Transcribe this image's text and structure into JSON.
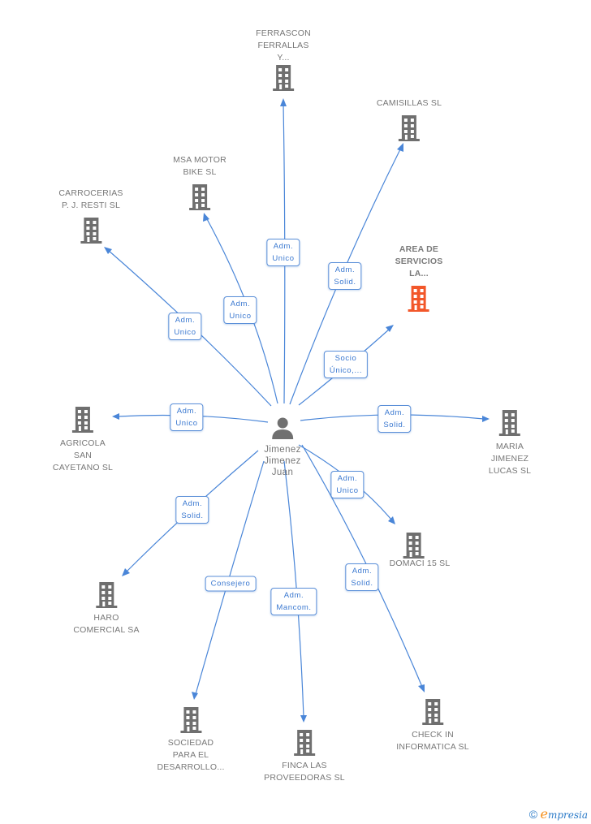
{
  "center": {
    "name_lines": [
      "Jimenez",
      "Jimenez",
      "Juan"
    ],
    "icon": "person-icon"
  },
  "companies": [
    {
      "id": "ferrascon",
      "lines": [
        "FERRASCON",
        "FERRALLAS",
        "Y..."
      ],
      "relation_lines": [
        "Adm.",
        "Unico"
      ],
      "highlight": false,
      "icon": "building-icon"
    },
    {
      "id": "camisillas",
      "lines": [
        "CAMISILLAS  SL"
      ],
      "relation_lines": [
        "Adm.",
        "Solid."
      ],
      "highlight": false,
      "icon": "building-icon"
    },
    {
      "id": "msa-motor",
      "lines": [
        "MSA MOTOR",
        "BIKE SL"
      ],
      "relation_lines": [
        "Adm.",
        "Unico"
      ],
      "highlight": false,
      "icon": "building-icon"
    },
    {
      "id": "carrocerias",
      "lines": [
        "CARROCERIAS",
        "P.  J. RESTI  SL"
      ],
      "relation_lines": [
        "Adm.",
        "Unico"
      ],
      "highlight": false,
      "icon": "building-icon"
    },
    {
      "id": "area-servicios",
      "lines": [
        "AREA DE",
        "SERVICIOS",
        "LA..."
      ],
      "relation_lines": [
        "Socio",
        "Único,..."
      ],
      "highlight": true,
      "icon": "building-icon"
    },
    {
      "id": "agricola",
      "lines": [
        "AGRICOLA",
        "SAN",
        "CAYETANO SL"
      ],
      "relation_lines": [
        "Adm.",
        "Unico"
      ],
      "highlight": false,
      "icon": "building-icon"
    },
    {
      "id": "maria-jimenez",
      "lines": [
        "MARIA",
        "JIMENEZ",
        "LUCAS SL"
      ],
      "relation_lines": [
        "Adm.",
        "Solid."
      ],
      "highlight": false,
      "icon": "building-icon"
    },
    {
      "id": "domaci",
      "lines": [
        "DOMACI 15 SL"
      ],
      "relation_lines": [
        "Adm.",
        "Unico"
      ],
      "highlight": false,
      "icon": "building-icon"
    },
    {
      "id": "haro",
      "lines": [
        "HARO",
        "COMERCIAL SA"
      ],
      "relation_lines": [
        "Adm.",
        "Solid."
      ],
      "highlight": false,
      "icon": "building-icon"
    },
    {
      "id": "sociedad",
      "lines": [
        "SOCIEDAD",
        "PARA EL",
        "DESARROLLO..."
      ],
      "relation_lines": [
        "Consejero"
      ],
      "highlight": false,
      "icon": "building-icon"
    },
    {
      "id": "finca",
      "lines": [
        "FINCA LAS",
        "PROVEEDORAS SL"
      ],
      "relation_lines": [
        "Adm.",
        "Mancom."
      ],
      "highlight": false,
      "icon": "building-icon"
    },
    {
      "id": "check-in",
      "lines": [
        "CHECK IN",
        "INFORMATICA SL"
      ],
      "relation_lines": [
        "Adm.",
        "Solid."
      ],
      "highlight": false,
      "icon": "building-icon"
    }
  ],
  "colors": {
    "edge": "#4a86d8",
    "building": "#6f6f6f",
    "building_highlight": "#f2572a",
    "label_text": "#777777",
    "edge_label_text": "#3a78d0"
  },
  "footer": {
    "copyright": "©",
    "brand_initial": "e",
    "brand_rest": "mpresia"
  }
}
